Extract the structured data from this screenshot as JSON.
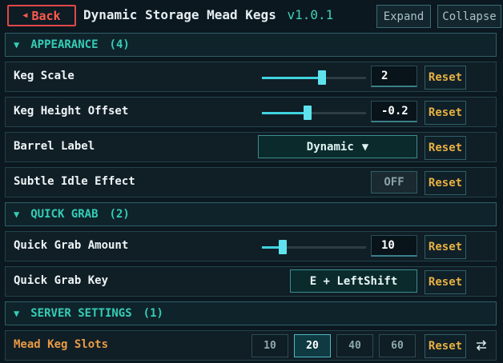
{
  "header": {
    "back_label": "Back",
    "back_icon": "◀",
    "title": "Dynamic Storage Mead Kegs",
    "version": "v1.0.1",
    "expand_label": "Expand",
    "collapse_label": "Collapse"
  },
  "sections": [
    {
      "arrow": "▼",
      "title": "APPEARANCE",
      "count": "(4)"
    },
    {
      "arrow": "▼",
      "title": "QUICK GRAB",
      "count": "(2)"
    },
    {
      "arrow": "▼",
      "title": "SERVER SETTINGS",
      "count": "(1)"
    }
  ],
  "rows": {
    "keg_scale": {
      "label": "Keg Scale",
      "value": "2",
      "slider_fraction": 0.56,
      "reset": "Reset"
    },
    "keg_height": {
      "label": "Keg Height Offset",
      "value": "-0.2",
      "slider_fraction": 0.45,
      "reset": "Reset"
    },
    "barrel_label": {
      "label": "Barrel Label",
      "selected": "Dynamic",
      "dropdown_icon": "▼",
      "reset": "Reset"
    },
    "idle_effect": {
      "label": "Subtle Idle Effect",
      "state": "OFF",
      "reset": "Reset"
    },
    "quick_grab_amount": {
      "label": "Quick Grab Amount",
      "value": "10",
      "slider_fraction": 0.2,
      "reset": "Reset"
    },
    "quick_grab_key": {
      "label": "Quick Grab Key",
      "binding": "E + LeftShift",
      "reset": "Reset"
    },
    "mead_keg_slots": {
      "label": "Mead Keg Slots",
      "options": [
        "10",
        "20",
        "40",
        "60"
      ],
      "selected": "20",
      "reset": "Reset",
      "icon": "swap-icon"
    }
  },
  "colors": {
    "background": "#0b1820",
    "accent_teal": "#35cdb5",
    "reset_gold": "#e6b042",
    "back_red": "#ff5a4f",
    "server_label_orange": "#e89a45"
  }
}
